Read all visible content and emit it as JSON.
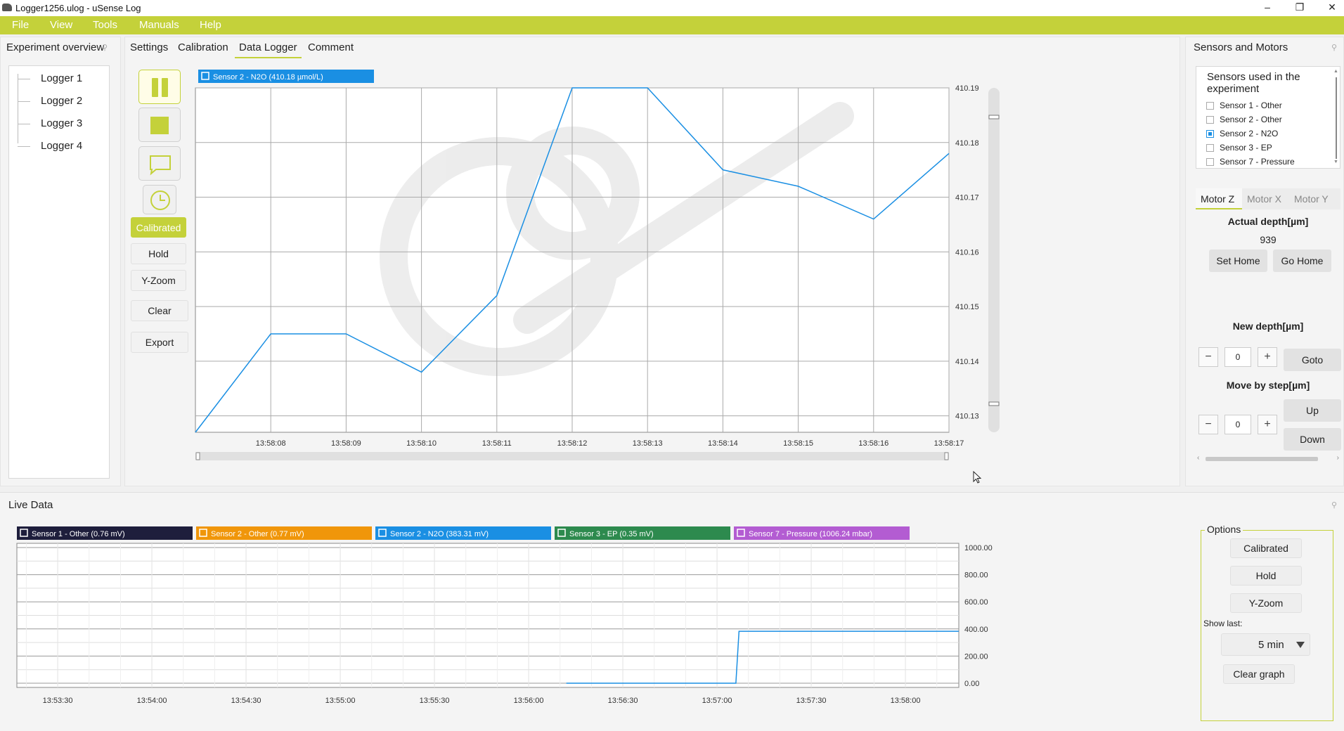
{
  "window": {
    "title": "Logger1256.ulog - uSense Log",
    "minimize": "–",
    "maximize": "❐",
    "close": "✕"
  },
  "menu": [
    "File",
    "View",
    "Tools",
    "Manuals",
    "Help"
  ],
  "experiment": {
    "title": "Experiment overview",
    "loggers": [
      "Logger 1",
      "Logger 2",
      "Logger 3",
      "Logger 4"
    ]
  },
  "tabs": [
    "Settings",
    "Calibration",
    "Data Logger",
    "Comment"
  ],
  "active_tab": "Data Logger",
  "controls": {
    "calibrated": "Calibrated",
    "hold": "Hold",
    "yzoom": "Y-Zoom",
    "clear": "Clear",
    "export": "Export"
  },
  "colors": {
    "accent": "#c4d13a",
    "series_blue": "#1a8fe3",
    "sensor1": "#1e1e3c",
    "sensor2_other": "#f0960a",
    "sensor2_n2o": "#1a8fe3",
    "sensor3": "#2d8a4e",
    "sensor7": "#b35cd2"
  },
  "main_chart_data": {
    "type": "line",
    "legend": "Sensor 2 - N2O (410.18 µmol/L)",
    "x": [
      "13:58:07",
      "13:58:08",
      "13:58:09",
      "13:58:10",
      "13:58:11",
      "13:58:12",
      "13:58:13",
      "13:58:14",
      "13:58:15",
      "13:58:16",
      "13:58:17"
    ],
    "x_ticks": [
      "13:58:08",
      "13:58:09",
      "13:58:10",
      "13:58:11",
      "13:58:12",
      "13:58:13",
      "13:58:14",
      "13:58:15",
      "13:58:16",
      "13:58:17"
    ],
    "values": [
      410.127,
      410.145,
      410.145,
      410.138,
      410.152,
      410.19,
      410.19,
      410.175,
      410.172,
      410.166,
      410.178
    ],
    "y_ticks": [
      "410.19",
      "410.18",
      "410.17",
      "410.16",
      "410.15",
      "410.14",
      "410.13"
    ],
    "ylim": [
      410.127,
      410.19
    ]
  },
  "sensors_motors": {
    "title": "Sensors and Motors",
    "list_title": "Sensors used in the experiment",
    "sensors": [
      {
        "label": "Sensor 1 - Other",
        "checked": false
      },
      {
        "label": "Sensor 2 - Other",
        "checked": false
      },
      {
        "label": "Sensor 2 - N2O",
        "checked": true
      },
      {
        "label": "Sensor 3 - EP",
        "checked": false
      },
      {
        "label": "Sensor 7 - Pressure",
        "checked": false
      }
    ],
    "motor_tabs": [
      "Motor Z",
      "Motor X",
      "Motor Y"
    ],
    "actual_depth_label": "Actual depth[µm]",
    "actual_depth_value": "939",
    "set_home": "Set Home",
    "go_home": "Go Home",
    "new_depth_label": "New depth[µm]",
    "new_depth_value": "0",
    "goto": "Goto",
    "step_label": "Move by step[µm]",
    "step_value": "0",
    "up": "Up",
    "down": "Down",
    "minus": "−",
    "plus": "+"
  },
  "live": {
    "title": "Live Data",
    "chart_data": {
      "type": "line",
      "legend": [
        "Sensor 1 - Other (0.76 mV)",
        "Sensor 2 - Other (0.77 mV)",
        "Sensor 2 - N2O (383.31 mV)",
        "Sensor 3 - EP (0.35 mV)",
        "Sensor 7 - Pressure (1006.24 mbar)"
      ],
      "x_ticks": [
        "13:53:30",
        "13:54:00",
        "13:54:30",
        "13:55:00",
        "13:55:30",
        "13:56:00",
        "13:56:30",
        "13:57:00",
        "13:57:30",
        "13:58:00"
      ],
      "y_ticks": [
        "1000.00",
        "800.00",
        "600.00",
        "400.00",
        "200.00",
        "0.00"
      ],
      "ylim": [
        0,
        1000
      ],
      "series": [
        {
          "name": "Sensor 2 - N2O",
          "x": [
            "13:56:12",
            "13:57:06",
            "13:57:07",
            "13:58:17"
          ],
          "values": [
            0,
            0,
            383,
            383
          ]
        }
      ]
    },
    "options": {
      "title": "Options",
      "calibrated": "Calibrated",
      "hold": "Hold",
      "yzoom": "Y-Zoom",
      "show_last_label": "Show last:",
      "show_last_value": "5 min",
      "clear_graph": "Clear graph"
    }
  }
}
